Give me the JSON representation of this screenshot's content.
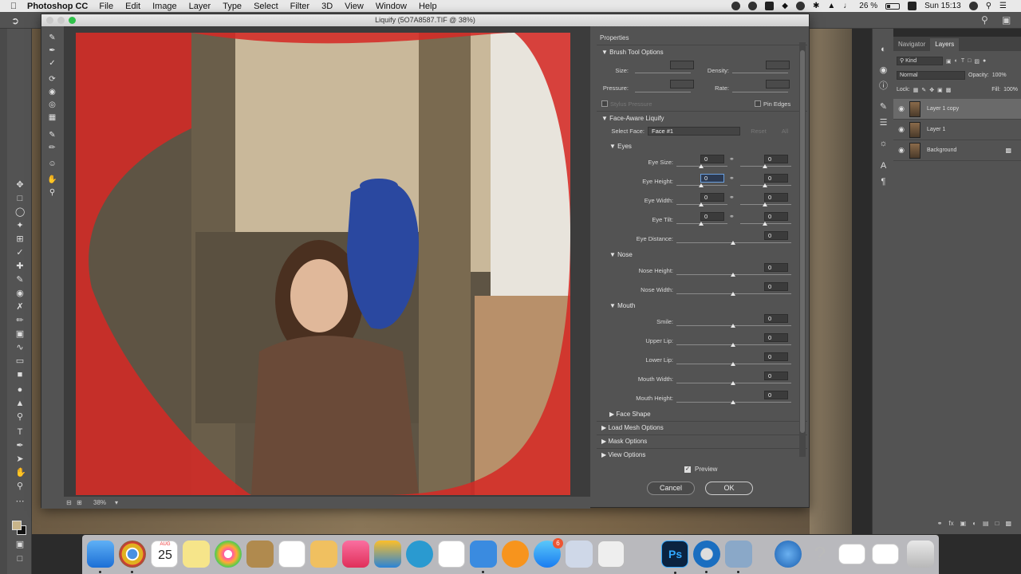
{
  "menubar": {
    "app_name": "Photoshop CC",
    "items": [
      "File",
      "Edit",
      "Image",
      "Layer",
      "Type",
      "Select",
      "Filter",
      "3D",
      "View",
      "Window",
      "Help"
    ],
    "battery": "26 %",
    "clock": "Sun 15:13"
  },
  "dialog": {
    "title": "Liquify (5O7A8587.TIF @ 38%)",
    "zoom": "38%",
    "properties_title": "Properties",
    "brush": {
      "header": "Brush Tool Options",
      "size_label": "Size:",
      "density_label": "Density:",
      "pressure_label": "Pressure:",
      "rate_label": "Rate:",
      "stylus_label": "Stylus Pressure",
      "pin_edges_label": "Pin Edges"
    },
    "face_aware": {
      "header": "Face-Aware Liquify",
      "select_face_label": "Select Face:",
      "select_face_value": "Face #1",
      "reset_label": "Reset",
      "all_label": "All",
      "eyes": {
        "header": "Eyes",
        "size_label": "Eye Size:",
        "height_label": "Eye Height:",
        "width_label": "Eye Width:",
        "tilt_label": "Eye Tilt:",
        "distance_label": "Eye Distance:",
        "size_l": "0",
        "size_r": "0",
        "height_l": "0",
        "height_r": "0",
        "width_l": "0",
        "width_r": "0",
        "tilt_l": "0",
        "tilt_r": "0",
        "distance": "0"
      },
      "nose": {
        "header": "Nose",
        "height_label": "Nose Height:",
        "width_label": "Nose Width:",
        "height": "0",
        "width": "0"
      },
      "mouth": {
        "header": "Mouth",
        "smile_label": "Smile:",
        "upper_lip_label": "Upper Lip:",
        "lower_lip_label": "Lower Lip:",
        "mouth_width_label": "Mouth Width:",
        "mouth_height_label": "Mouth Height:",
        "smile": "0",
        "upper_lip": "0",
        "lower_lip": "0",
        "mouth_width": "0",
        "mouth_height": "0"
      },
      "face_shape_header": "Face Shape"
    },
    "load_mesh_header": "Load Mesh Options",
    "mask_header": "Mask Options",
    "view_header": "View Options",
    "preview_label": "Preview",
    "preview_checked": true,
    "cancel_label": "Cancel",
    "ok_label": "OK"
  },
  "layers_panel": {
    "tabs": [
      "Navigator",
      "Layers"
    ],
    "active_tab": "Layers",
    "kind_label": "Kind",
    "blend_mode": "Normal",
    "opacity_label": "Opacity:",
    "opacity": "100%",
    "lock_label": "Lock:",
    "fill_label": "Fill:",
    "fill": "100%",
    "layers": [
      {
        "name": "Layer 1 copy",
        "selected": true
      },
      {
        "name": "Layer 1",
        "selected": false
      },
      {
        "name": "Background",
        "selected": false,
        "locked": true
      }
    ]
  },
  "dock": {
    "calendar_month": "AUG",
    "calendar_day": "25",
    "appstore_badge": "6"
  },
  "colors": {
    "mask_red": "#d42a26",
    "panel_bg": "#535353",
    "accent_blue": "#6aa0e0"
  }
}
